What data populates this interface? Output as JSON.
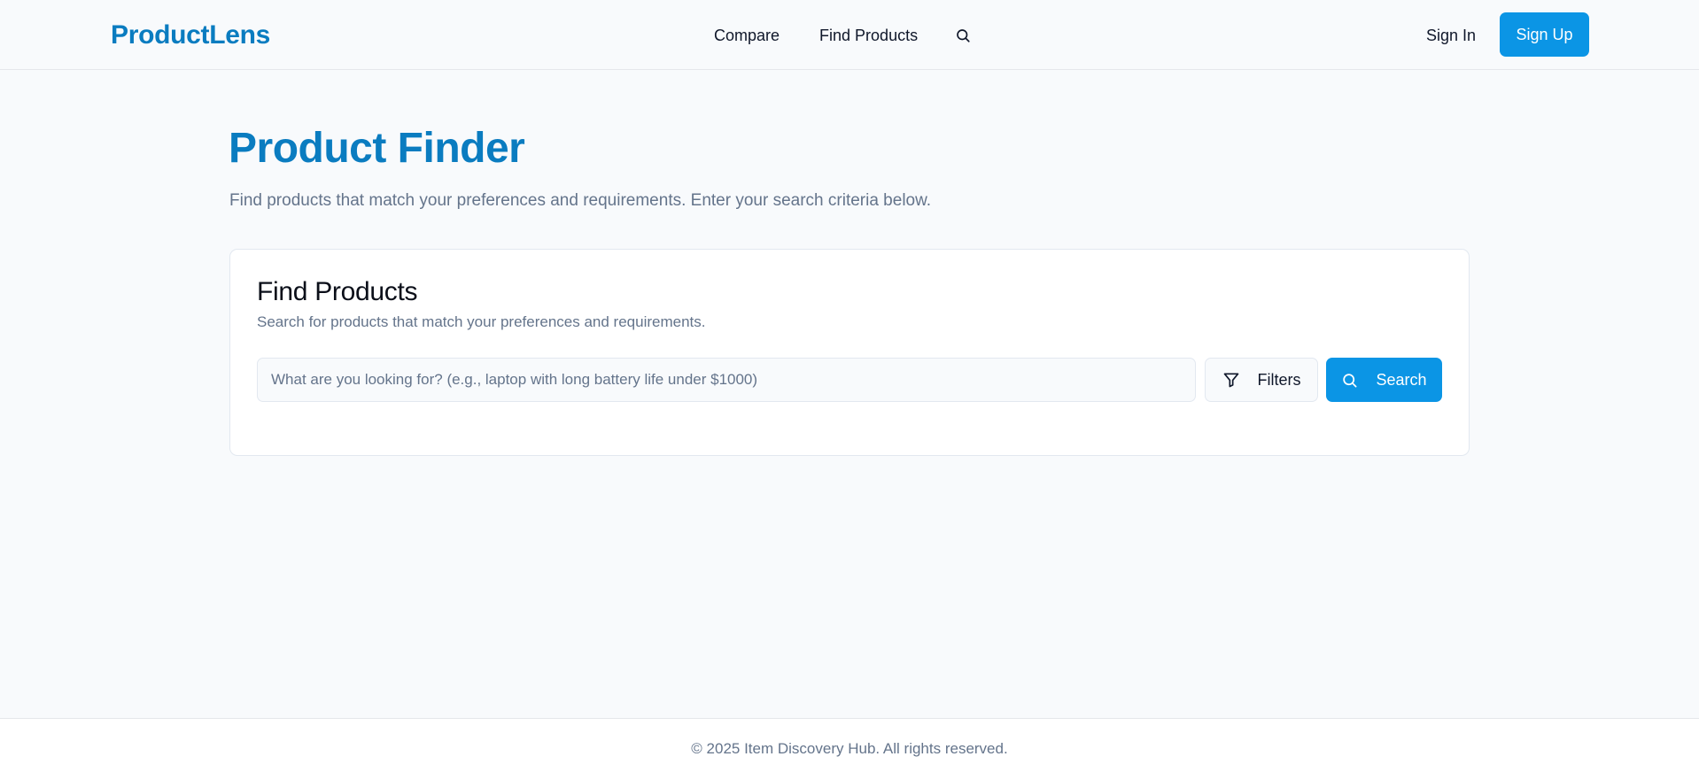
{
  "header": {
    "brand": "ProductLens",
    "nav": {
      "compare": "Compare",
      "find_products": "Find Products"
    },
    "search_icon": "search-icon",
    "sign_in": "Sign In",
    "sign_up": "Sign Up"
  },
  "hero": {
    "title": "Product Finder",
    "subtitle": "Find products that match your preferences and requirements. Enter your search criteria below."
  },
  "finder_card": {
    "title": "Find Products",
    "subtitle": "Search for products that match your preferences and requirements.",
    "search_input": {
      "value": "",
      "placeholder": "What are you looking for? (e.g., laptop with long battery life under $1000)"
    },
    "filters_button": {
      "label": "Filters",
      "icon": "filter-icon"
    },
    "search_button": {
      "label": "Search",
      "icon": "search-icon"
    }
  },
  "footer": {
    "text": "© 2025 Item Discovery Hub. All rights reserved."
  },
  "colors": {
    "brand": "#0a7cc0",
    "primary_button": "#0b95e5",
    "page_background": "#f8fafc",
    "muted_text": "#64748b"
  }
}
